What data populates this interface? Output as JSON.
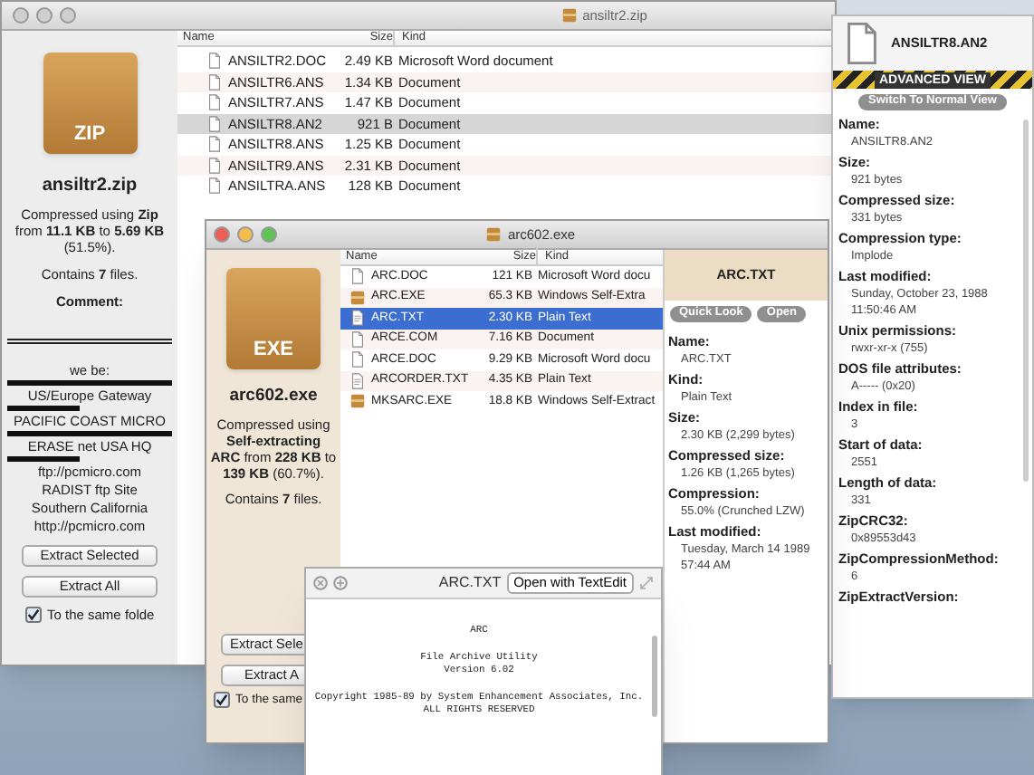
{
  "archive_window": {
    "title": "ansiltr2.zip",
    "active": false,
    "summary": {
      "badge": "ZIP",
      "name": "ansiltr2.zip",
      "description": "Compressed using **Zip** from **11.1 KB** to **5.69 KB** (51.5%).",
      "contents": "Contains **7** files.",
      "comment_label": "Comment:",
      "comment_lines": [
        "we be:",
        "US/Europe Gateway",
        "PACIFIC COAST MICRO",
        "ERASE net USA HQ",
        "ftp://pcmicro.com",
        "RADIST ftp Site",
        "Southern California",
        "http://pcmicro.com"
      ]
    },
    "buttons": [
      "Extract Selected",
      "Extract All"
    ],
    "same_folder": {
      "label": "To the same folde",
      "checked": true
    },
    "columns": [
      "Name",
      "Size",
      "Kind"
    ],
    "rows": [
      {
        "name": "ANSILTR2.DOC",
        "size": "2.49 KB",
        "file_type": "Microsoft Word document",
        "kind": "document",
        "selected": false
      },
      {
        "name": "ANSILTR6.ANS",
        "size": "1.34 KB",
        "file_type": "Document",
        "kind": "document",
        "selected": false
      },
      {
        "name": "ANSILTR7.ANS",
        "size": "1.47 KB",
        "file_type": "Document",
        "kind": "document",
        "selected": false
      },
      {
        "name": "ANSILTR8.AN2",
        "size": "921 B",
        "file_type": "Document",
        "kind": "document",
        "selected": true
      },
      {
        "name": "ANSILTR8.ANS",
        "size": "1.25 KB",
        "file_type": "Document",
        "kind": "document",
        "selected": false
      },
      {
        "name": "ANSILTR9.ANS",
        "size": "2.31 KB",
        "file_type": "Document",
        "kind": "document",
        "selected": false
      },
      {
        "name": "ANSILTRA.ANS",
        "size": "128 KB",
        "file_type": "Document",
        "kind": "document",
        "selected": false
      }
    ]
  },
  "advanced_info": {
    "file_name": "ANSILTR8.AN2",
    "banner": "ADVANCED VIEW",
    "button": "Switch To Normal View",
    "fields": [
      {
        "label": "Name:",
        "value": [
          "ANSILTR8.AN2"
        ]
      },
      {
        "label": "Size:",
        "value": [
          "921 bytes"
        ]
      },
      {
        "label": "Compressed size:",
        "value": [
          "331 bytes"
        ]
      },
      {
        "label": "Compression type:",
        "value": [
          "Implode"
        ]
      },
      {
        "label": "Last modified:",
        "value": [
          "Sunday, October 23, 1988",
          "11:50:46 AM"
        ]
      },
      {
        "label": "Unix permissions:",
        "value": [
          "rwxr-xr-x (755)"
        ]
      },
      {
        "label": "DOS file attributes:",
        "value": [
          "A----- (0x20)"
        ]
      },
      {
        "label": "Index in file:",
        "value": [
          "3"
        ]
      },
      {
        "label": "Start of data:",
        "value": [
          "2551"
        ]
      },
      {
        "label": "Length of data:",
        "value": [
          "331"
        ]
      },
      {
        "label": "ZipCRC32:",
        "value": [
          "0x89553d43"
        ]
      },
      {
        "label": "ZipCompressionMethod:",
        "value": [
          "6"
        ]
      },
      {
        "label": "ZipExtractVersion:"
      }
    ]
  },
  "exe_window": {
    "title": "arc602.exe",
    "active": true,
    "summary": {
      "badge": "EXE",
      "name": "arc602.exe",
      "description": "Compressed using **Self-extracting ARC** from **228 KB** to **139 KB** (60.7%).",
      "contents": "Contains **7** files."
    },
    "buttons": [
      "Extract Sele",
      "Extract A"
    ],
    "same_folder": {
      "label": "To the same",
      "checked": true
    },
    "columns": [
      "Name",
      "Size",
      "Kind"
    ],
    "rows": [
      {
        "name": "ARC.DOC",
        "size": "121 KB",
        "file_type": "Microsoft Word docu",
        "kind": "document",
        "selected": false
      },
      {
        "name": "ARC.EXE",
        "size": "65.3 KB",
        "file_type": "Windows Self-Extra",
        "kind": "archive",
        "selected": false
      },
      {
        "name": "ARC.TXT",
        "size": "2.30 KB",
        "file_type": "Plain Text",
        "kind": "text",
        "selected": true
      },
      {
        "name": "ARCE.COM",
        "size": "7.16 KB",
        "file_type": "Document",
        "kind": "document",
        "selected": false
      },
      {
        "name": "ARCE.DOC",
        "size": "9.29 KB",
        "file_type": "Microsoft Word docu",
        "kind": "document",
        "selected": false
      },
      {
        "name": "ARCORDER.TXT",
        "size": "4.35 KB",
        "file_type": "Plain Text",
        "kind": "text",
        "selected": false
      },
      {
        "name": "MKSARC.EXE",
        "size": "18.8 KB",
        "file_type": "Windows Self-Extract",
        "kind": "archive",
        "selected": false
      }
    ],
    "info": {
      "file_name": "ARC.TXT",
      "buttons": [
        "Quick Look",
        "Open"
      ],
      "fields": [
        {
          "label": "Name:",
          "value": [
            "ARC.TXT"
          ]
        },
        {
          "label": "Kind:",
          "value": [
            "Plain Text"
          ]
        },
        {
          "label": "Size:",
          "value": [
            "2.30 KB (2,299 bytes)"
          ]
        },
        {
          "label": "Compressed size:",
          "value": [
            "1.26 KB (1,265 bytes)"
          ]
        },
        {
          "label": "Compression:",
          "value": [
            "55.0% (Crunched LZW)"
          ]
        },
        {
          "label": "Last modified:",
          "value": [
            "Tuesday, March 14 1989",
            "57:44 AM"
          ]
        }
      ]
    }
  },
  "quick_look": {
    "title": "ARC.TXT",
    "button": "Open with TextEdit",
    "paragraphs": [
      [
        "ARC"
      ],
      [
        "File Archive Utility",
        "Version 6.02"
      ],
      [
        "Copyright 1985-89 by System Enhancement Associates, Inc.",
        "ALL RIGHTS RESERVED"
      ]
    ]
  }
}
